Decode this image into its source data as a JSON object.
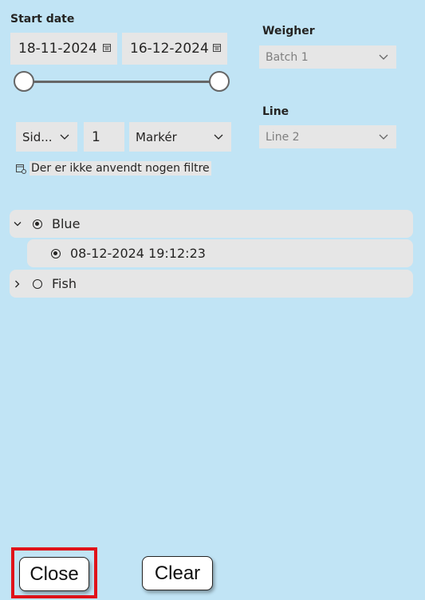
{
  "date_filter": {
    "label": "Start date",
    "start_date": "18-11-2024",
    "end_date": "16-12-2024",
    "calendar_icon": "calendar-icon"
  },
  "weigher": {
    "label": "Weigher",
    "selected": "Batch 1"
  },
  "line": {
    "label": "Line",
    "selected": "Line 2"
  },
  "relative_filter": {
    "period_value": "Sid...",
    "number_value": "1",
    "unit_value": "Markér"
  },
  "filter_note": {
    "text": "Der er ikke anvendt nogen filtre",
    "icon": "calendar-filter-icon"
  },
  "tree": {
    "items": [
      {
        "label": "Blue",
        "selected": true,
        "expanded": true,
        "children": [
          {
            "label": "08-12-2024 19:12:23",
            "selected": true
          }
        ]
      },
      {
        "label": "Fish",
        "selected": false,
        "expanded": false
      }
    ]
  },
  "buttons": {
    "close_label": "Close",
    "clear_label": "Clear"
  },
  "colors": {
    "background": "#c1e4f5",
    "field": "#e6e6e6",
    "highlight": "#e0131a"
  }
}
